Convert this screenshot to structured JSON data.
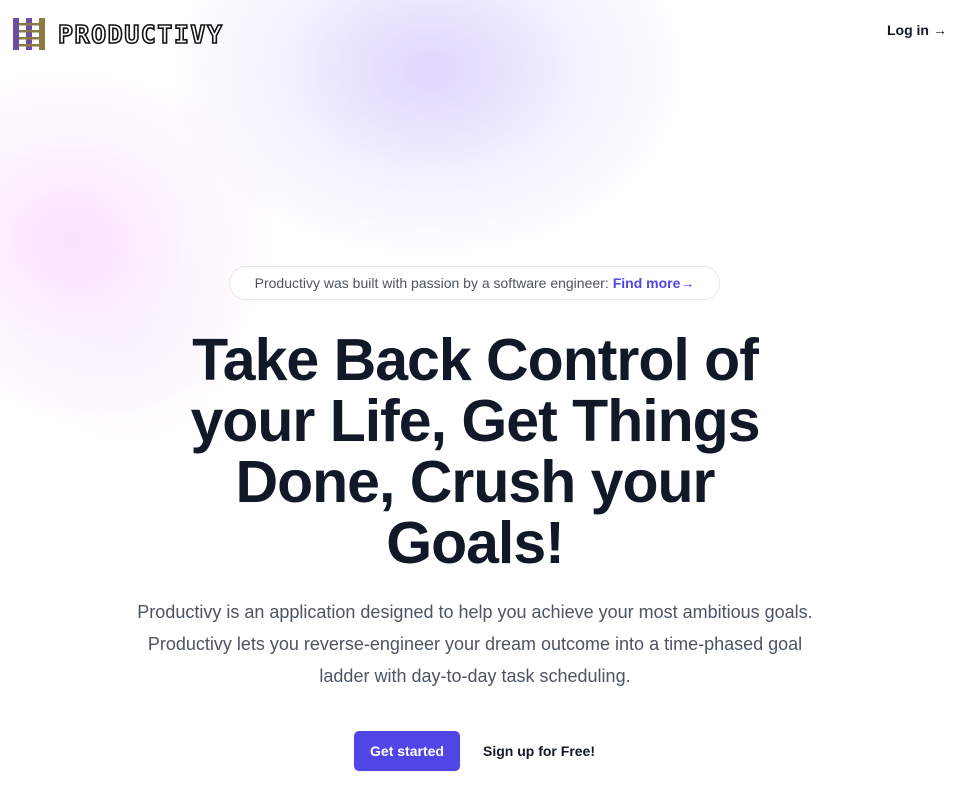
{
  "brand": {
    "name": "PRODUCTIVY",
    "logo_icon": "ladder-logo-icon",
    "logo_colors": [
      "#6b4fa0",
      "#8a7a45"
    ]
  },
  "header": {
    "login_label": "Log in",
    "login_arrow": "→"
  },
  "announcement": {
    "text": "Productivy was built with passion by a software engineer:",
    "link_label": "Find more",
    "link_arrow": "→"
  },
  "hero": {
    "title": "Take Back Control of your Life, Get Things Done, Crush your Goals!",
    "subtitle": "Productivy is an application designed to help you achieve your most ambitious goals. Productivy lets you reverse-engineer your dream outcome into a time-phased goal ladder with day-to-day task scheduling."
  },
  "cta": {
    "primary_label": "Get started",
    "secondary_label": "Sign up for Free!"
  },
  "colors": {
    "accent": "#4f46e5",
    "text": "#111827",
    "muted": "#4b5563"
  }
}
